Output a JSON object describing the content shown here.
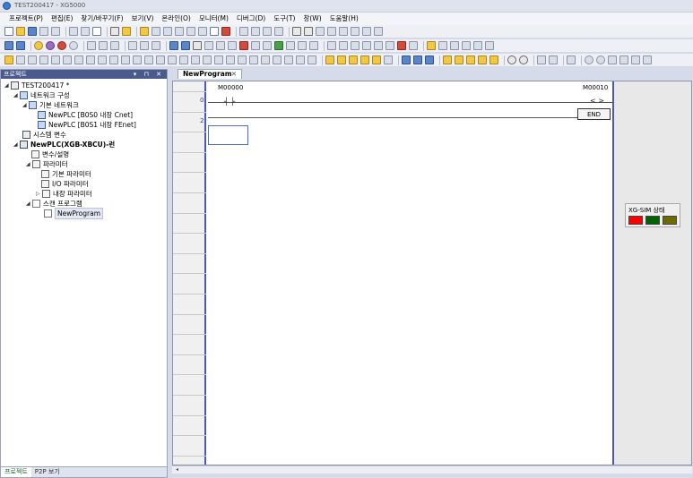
{
  "window": {
    "title": "TEST200417 - XG5000"
  },
  "menu": [
    "프로젝트(P)",
    "편집(E)",
    "찾기/바꾸기(F)",
    "보기(V)",
    "온라인(O)",
    "모니터(M)",
    "디버그(D)",
    "도구(T)",
    "창(W)",
    "도움말(H)"
  ],
  "project_panel": {
    "header": "프로젝트",
    "header_buttons": "▾ ⊓ ✕",
    "tree": [
      {
        "label": "TEST200417 *"
      },
      {
        "label": "네트워크 구성"
      },
      {
        "label": "기본 네트워크"
      },
      {
        "label": "NewPLC [B0S0 내장 Cnet]"
      },
      {
        "label": "NewPLC [B0S1 내장 FEnet]"
      },
      {
        "label": "시스템 변수"
      },
      {
        "label": "NewPLC(XGB-XBCU)-런"
      },
      {
        "label": "변수/설명"
      },
      {
        "label": "파라미터"
      },
      {
        "label": "기본 파라미터"
      },
      {
        "label": "I/O 파라미터"
      },
      {
        "label": "내장 파라미터"
      },
      {
        "label": "스캔 프로그램"
      },
      {
        "label": "NewProgram"
      }
    ],
    "tabs": [
      "프로젝트",
      "P2P 보기"
    ]
  },
  "editor": {
    "tab_label": "NewProgram",
    "tab_close": "✕",
    "rows": [
      "0",
      "2"
    ],
    "contact": {
      "address": "M00000",
      "symbol": "┤ ├"
    },
    "coil": {
      "address": "M00010",
      "symbol": "<  >"
    },
    "end_label": "END"
  },
  "sim_status": {
    "label": "XG-SIM 상태",
    "lamps": [
      "#ff0000",
      "#006400",
      "#6b6b00"
    ]
  },
  "colors": {
    "accent": "#4b57b9",
    "panel_header": "#4a5a8c"
  }
}
